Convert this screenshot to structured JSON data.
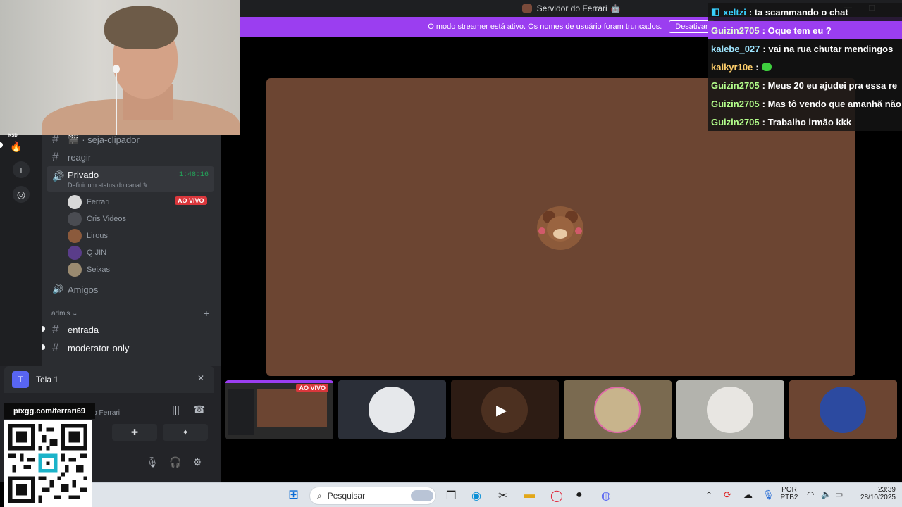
{
  "window": {
    "title": "Servidor do Ferrari",
    "title_icon": "robot-emoji-icon",
    "controls": [
      "minimize",
      "maximize",
      "close"
    ]
  },
  "banner": {
    "text": "O modo streamer está ativo. Os nomes de usuário foram truncados.",
    "button": "Desativar",
    "close": "×"
  },
  "rail": {
    "server_tag": "KSD",
    "add_icon": "+",
    "discover_icon": "compass"
  },
  "channels": {
    "items": [
      {
        "name": "· seja-clipador",
        "emoji": "🎬"
      },
      {
        "name": "reagir"
      }
    ],
    "voice": {
      "name": "Privado",
      "status": "Definir um status do canal",
      "time": "1:48:16",
      "members": [
        {
          "name": "Ferrari",
          "live": "AO VIVO"
        },
        {
          "name": "Cris Videos"
        },
        {
          "name": "Lirous"
        },
        {
          "name": "Q JIN"
        },
        {
          "name": "Seixas"
        }
      ]
    },
    "amigos": "Amigos",
    "category": "adm's",
    "category_items": [
      "entrada",
      "moderator-only"
    ]
  },
  "panel": {
    "stream_title": "Tela 1",
    "stream_initial": "T",
    "connected": "lo Ferrari"
  },
  "overlay": {
    "qr_label": "pixgg.com/ferrari69"
  },
  "thumbs": {
    "live_badge": "AO VIVO"
  },
  "chat": [
    {
      "user": "xeltzi",
      "text": ": ta scammando o chat",
      "color": "#39d0ff",
      "highlight": false
    },
    {
      "user": "Guizin2705",
      "text": ": Oque tem eu ?",
      "color": "#b4ff8c",
      "highlight": true
    },
    {
      "user": "kalebe_027",
      "text": ": vai na rua chutar mendingos",
      "color": "#9fe6ff",
      "highlight": false
    },
    {
      "user": "kaikyr10e",
      "text": ":",
      "color": "#ffcf6b",
      "highlight": false,
      "emote": true
    },
    {
      "user": "Guizin2705",
      "text": ": Meus 20 eu ajudei pra essa re",
      "color": "#b4ff8c",
      "highlight": false
    },
    {
      "user": "Guizin2705",
      "text": ": Mas tô vendo que amanhã não",
      "color": "#b4ff8c",
      "highlight": false
    },
    {
      "user": "Guizin2705",
      "text": ": Trabalho irmão kkk",
      "color": "#b4ff8c",
      "highlight": false
    }
  ],
  "taskbar": {
    "search_placeholder": "Pesquisar",
    "lang_top": "POR",
    "lang_bottom": "PTB2",
    "time": "23:39",
    "date": "28/10/2025"
  }
}
